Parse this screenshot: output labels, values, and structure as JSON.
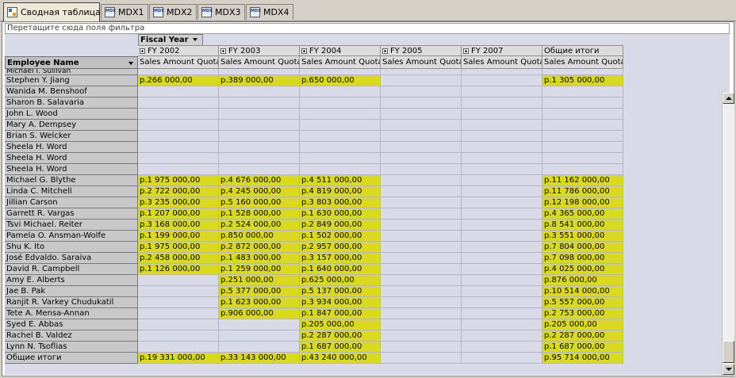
{
  "tabs": [
    {
      "label": "Сводная таблица",
      "icon": "pivot-table-icon",
      "active": true
    },
    {
      "label": "MDX1",
      "icon": "mdx-query-icon",
      "active": false
    },
    {
      "label": "MDX2",
      "icon": "mdx-query-icon",
      "active": false
    },
    {
      "label": "MDX3",
      "icon": "mdx-query-icon",
      "active": false
    },
    {
      "label": "MDX4",
      "icon": "mdx-query-icon",
      "active": false
    }
  ],
  "filter_zone_text": "Перетащите сюда поля фильтра",
  "column_field": "Fiscal Year",
  "row_field": "Employee Name",
  "columns": [
    {
      "label": "FY 2002",
      "expandable": true
    },
    {
      "label": "FY 2003",
      "expandable": true
    },
    {
      "label": "FY 2004",
      "expandable": true
    },
    {
      "label": "FY 2005",
      "expandable": true
    },
    {
      "label": "FY 2007",
      "expandable": true
    },
    {
      "label": "Общие итоги",
      "expandable": false
    }
  ],
  "measure_label": "Sales Amount Quota",
  "partial_row": "Michael I. Sullivan",
  "rows": [
    {
      "name": "Stephen Y. Jiang",
      "values": [
        "р.266 000,00",
        "р.389 000,00",
        "р.650 000,00",
        "",
        "",
        "р.1 305 000,00"
      ]
    },
    {
      "name": "Wanida M. Benshoof",
      "values": [
        "",
        "",
        "",
        "",
        "",
        ""
      ]
    },
    {
      "name": "Sharon B. Salavaria",
      "values": [
        "",
        "",
        "",
        "",
        "",
        ""
      ]
    },
    {
      "name": "John L. Wood",
      "values": [
        "",
        "",
        "",
        "",
        "",
        ""
      ]
    },
    {
      "name": "Mary A. Dempsey",
      "values": [
        "",
        "",
        "",
        "",
        "",
        ""
      ]
    },
    {
      "name": "Brian S. Welcker",
      "values": [
        "",
        "",
        "",
        "",
        "",
        ""
      ]
    },
    {
      "name": "Sheela H. Word",
      "values": [
        "",
        "",
        "",
        "",
        "",
        ""
      ]
    },
    {
      "name": "Sheela H. Word",
      "values": [
        "",
        "",
        "",
        "",
        "",
        ""
      ]
    },
    {
      "name": "Sheela H. Word",
      "values": [
        "",
        "",
        "",
        "",
        "",
        ""
      ]
    },
    {
      "name": "Michael G. Blythe",
      "values": [
        "р.1 975 000,00",
        "р.4 676 000,00",
        "р.4 511 000,00",
        "",
        "",
        "р.11 162 000,00"
      ]
    },
    {
      "name": "Linda C. Mitchell",
      "values": [
        "р.2 722 000,00",
        "р.4 245 000,00",
        "р.4 819 000,00",
        "",
        "",
        "р.11 786 000,00"
      ]
    },
    {
      "name": "Jillian Carson",
      "values": [
        "р.3 235 000,00",
        "р.5 160 000,00",
        "р.3 803 000,00",
        "",
        "",
        "р.12 198 000,00"
      ]
    },
    {
      "name": "Garrett R. Vargas",
      "values": [
        "р.1 207 000,00",
        "р.1 528 000,00",
        "р.1 630 000,00",
        "",
        "",
        "р.4 365 000,00"
      ]
    },
    {
      "name": "Tsvi Michael. Reiter",
      "values": [
        "р.3 168 000,00",
        "р.2 524 000,00",
        "р.2 849 000,00",
        "",
        "",
        "р.8 541 000,00"
      ]
    },
    {
      "name": "Pamela O. Ansman-Wolfe",
      "values": [
        "р.1 199 000,00",
        "р.850 000,00",
        "р.1 502 000,00",
        "",
        "",
        "р.3 551 000,00"
      ]
    },
    {
      "name": "Shu K. Ito",
      "values": [
        "р.1 975 000,00",
        "р.2 872 000,00",
        "р.2 957 000,00",
        "",
        "",
        "р.7 804 000,00"
      ]
    },
    {
      "name": "José Edvaldo. Saraiva",
      "values": [
        "р.2 458 000,00",
        "р.1 483 000,00",
        "р.3 157 000,00",
        "",
        "",
        "р.7 098 000,00"
      ]
    },
    {
      "name": "David R. Campbell",
      "values": [
        "р.1 126 000,00",
        "р.1 259 000,00",
        "р.1 640 000,00",
        "",
        "",
        "р.4 025 000,00"
      ]
    },
    {
      "name": "Amy E. Alberts",
      "values": [
        "",
        "р.251 000,00",
        "р.625 000,00",
        "",
        "",
        "р.876 000,00"
      ]
    },
    {
      "name": "Jae B. Pak",
      "values": [
        "",
        "р.5 377 000,00",
        "р.5 137 000,00",
        "",
        "",
        "р.10 514 000,00"
      ]
    },
    {
      "name": "Ranjit R. Varkey Chudukatil",
      "values": [
        "",
        "р.1 623 000,00",
        "р.3 934 000,00",
        "",
        "",
        "р.5 557 000,00"
      ]
    },
    {
      "name": "Tete A. Mensa-Annan",
      "values": [
        "",
        "р.906 000,00",
        "р.1 847 000,00",
        "",
        "",
        "р.2 753 000,00"
      ]
    },
    {
      "name": "Syed E. Abbas",
      "values": [
        "",
        "",
        "р.205 000,00",
        "",
        "",
        "р.205 000,00"
      ]
    },
    {
      "name": "Rachel B. Valdez",
      "values": [
        "",
        "",
        "р.2 287 000,00",
        "",
        "",
        "р.2 287 000,00"
      ]
    },
    {
      "name": "Lynn N. Tsoflias",
      "values": [
        "",
        "",
        "р.1 687 000,00",
        "",
        "",
        "р.1 687 000,00"
      ]
    },
    {
      "name": "Общие итоги",
      "values": [
        "р.19 331 000,00",
        "р.33 143 000,00",
        "р.43 240 000,00",
        "",
        "",
        "р.95 714 000,00"
      ]
    }
  ]
}
